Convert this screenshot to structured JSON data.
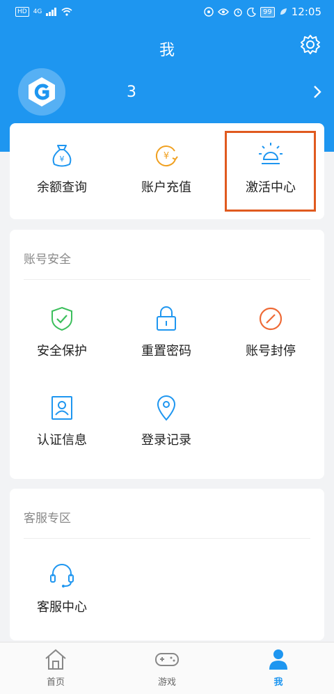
{
  "status_bar": {
    "left_text": "HD",
    "signal": "4G",
    "time": "12:05",
    "battery": "99"
  },
  "header": {
    "title": "我",
    "username": "3"
  },
  "top_actions": [
    {
      "label": "余额查询",
      "icon": "money-bag-icon"
    },
    {
      "label": "账户充值",
      "icon": "recharge-icon"
    },
    {
      "label": "激活中心",
      "icon": "bulb-icon"
    }
  ],
  "account_security": {
    "title": "账号安全",
    "items": [
      {
        "label": "安全保护",
        "icon": "shield-check-icon"
      },
      {
        "label": "重置密码",
        "icon": "lock-icon"
      },
      {
        "label": "账号封停",
        "icon": "ban-icon"
      },
      {
        "label": "认证信息",
        "icon": "id-card-icon"
      },
      {
        "label": "登录记录",
        "icon": "location-pin-icon"
      }
    ]
  },
  "customer_service": {
    "title": "客服专区",
    "items": [
      {
        "label": "客服中心",
        "icon": "headset-icon"
      }
    ]
  },
  "tabs": [
    {
      "label": "首页",
      "icon": "home-icon"
    },
    {
      "label": "游戏",
      "icon": "gamepad-icon"
    },
    {
      "label": "我",
      "icon": "user-icon"
    }
  ],
  "colors": {
    "brand_blue": "#1e96f0",
    "highlight_border": "#e05a1f"
  }
}
